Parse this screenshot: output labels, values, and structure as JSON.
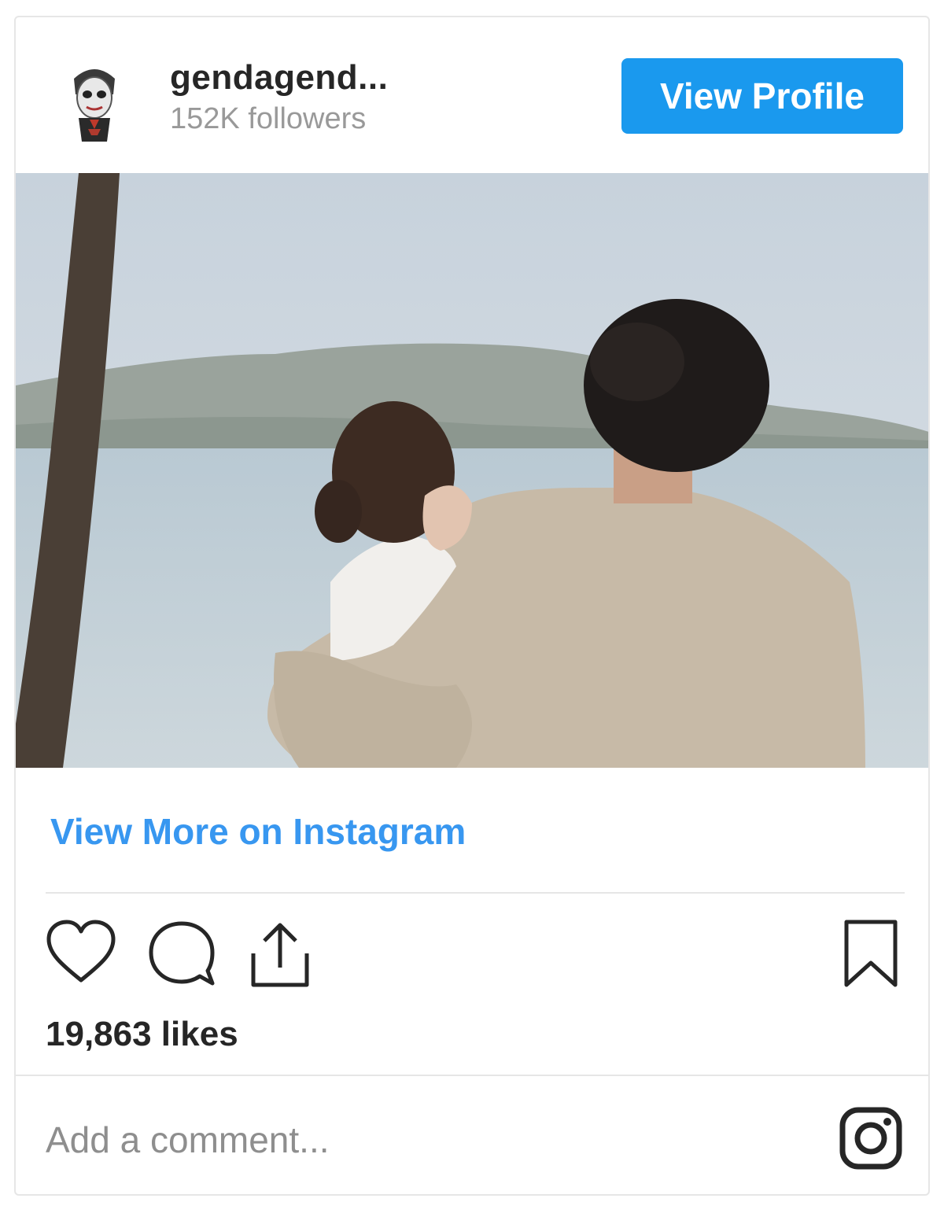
{
  "header": {
    "username": "gendagend...",
    "followers": "152K followers",
    "view_profile_label": "View Profile",
    "avatar_icon": "skull-mask-avatar"
  },
  "post": {
    "photo_description_icon": "couple-photo",
    "view_more_label": "View More on Instagram",
    "likes": "19,863 likes"
  },
  "actions": {
    "like_icon": "heart-icon",
    "comment_icon": "comment-icon",
    "share_icon": "share-icon",
    "save_icon": "bookmark-icon"
  },
  "comment": {
    "placeholder": "Add a comment...",
    "brand_icon": "instagram-icon"
  },
  "colors": {
    "accent": "#1a99ee",
    "link": "#3897f0",
    "text": "#262626",
    "muted": "#999999",
    "border": "#e6e6e6"
  }
}
